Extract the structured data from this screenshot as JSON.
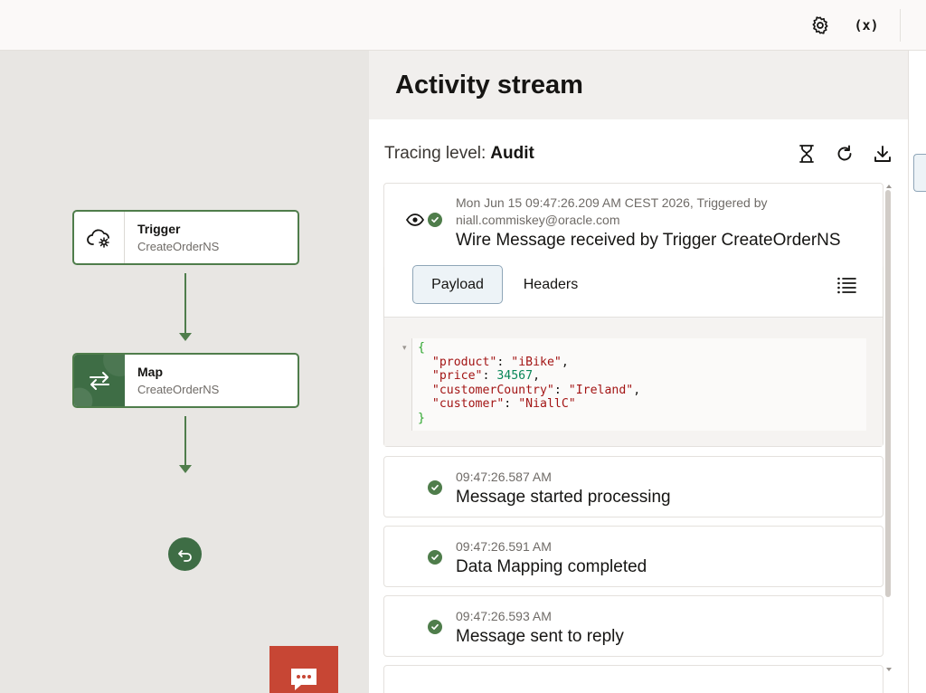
{
  "topbar": {
    "settings_icon": "gear-icon",
    "variables_label": "(x)"
  },
  "canvas": {
    "nodes": [
      {
        "title": "Trigger",
        "subtitle": "CreateOrderNS",
        "icon": "cloud-gear-icon"
      },
      {
        "title": "Map",
        "subtitle": "CreateOrderNS",
        "icon": "swap-arrows-icon"
      }
    ],
    "end_icon": "return-icon",
    "chat_icon": "chat-bubble-icon",
    "colors": {
      "node_border": "#4f7d4b",
      "map_fill": "#3e6d45",
      "chat_button": "#c74634"
    }
  },
  "panel": {
    "title": "Activity stream",
    "tracing_label": "Tracing level:",
    "tracing_value": "Audit",
    "actions": [
      "hourglass-icon",
      "refresh-icon",
      "download-icon"
    ],
    "first_event": {
      "meta_line1": "Mon Jun 15 09:47:26.209 AM CEST 2026, Triggered by",
      "meta_line2": "niall.commiskey@oracle.com",
      "message": "Wire Message received by Trigger CreateOrderNS",
      "tabs": [
        "Payload",
        "Headers"
      ],
      "active_tab": "Payload",
      "payload": {
        "open": "{",
        "product_key": "\"product\"",
        "product_val": "\"iBike\"",
        "price_key": "\"price\"",
        "price_val": "34567",
        "country_key": "\"customerCountry\"",
        "country_val": "\"Ireland\"",
        "customer_key": "\"customer\"",
        "customer_val": "\"NiallC\"",
        "close": "}"
      }
    },
    "events": [
      {
        "time": "09:47:26.587 AM",
        "message": "Message started processing"
      },
      {
        "time": "09:47:26.591 AM",
        "message": "Data Mapping completed"
      },
      {
        "time": "09:47:26.593 AM",
        "message": "Message sent to reply"
      }
    ]
  }
}
